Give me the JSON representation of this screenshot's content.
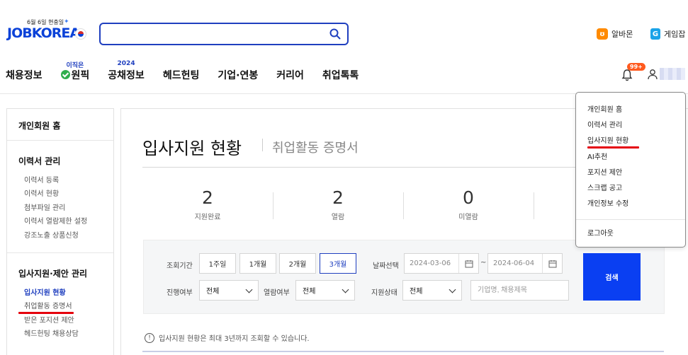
{
  "header": {
    "logo_tagline": "6월 6일 현충일",
    "logo_text": "JOBKOREA",
    "search_placeholder": "",
    "utils": [
      {
        "label": "알바몬",
        "badge": "ʊ"
      },
      {
        "label": "게임잡",
        "badge": "G"
      }
    ],
    "nav": [
      {
        "label": "채용정보",
        "sup": ""
      },
      {
        "label": "원픽",
        "sup": "이직은"
      },
      {
        "label": "공채정보",
        "sup": "2024"
      },
      {
        "label": "헤드헌팅",
        "sup": ""
      },
      {
        "label": "기업·연봉",
        "sup": ""
      },
      {
        "label": "커리어",
        "sup": ""
      },
      {
        "label": "취업톡톡",
        "sup": ""
      }
    ],
    "notification_badge": "99+"
  },
  "sidebar": {
    "home": "개인회원 홈",
    "sections": [
      {
        "title": "이력서 관리",
        "items": [
          "이력서 등록",
          "이력서 현황",
          "첨부파일 관리",
          "이력서 열람제한 설정",
          "강조노출 상품신청"
        ]
      },
      {
        "title": "입사지원·제안 관리",
        "items": [
          "입사지원 현황",
          "취업활동 증명서",
          "받은 포지션 제안",
          "헤드헌팅 채용상담"
        ]
      }
    ]
  },
  "main": {
    "title": "입사지원 현황",
    "subtitle": "취업활동 증명서",
    "stats": [
      {
        "value": "2",
        "label": "지원완료"
      },
      {
        "value": "2",
        "label": "열람"
      },
      {
        "value": "0",
        "label": "미열람"
      }
    ],
    "filter": {
      "period_label": "조회기간",
      "periods": [
        "1주일",
        "1개월",
        "2개월",
        "3개월"
      ],
      "active_period": "3개월",
      "date_label": "날짜선택",
      "date_from": "2024-03-06",
      "date_to": "2024-06-04",
      "tilde": "~",
      "progress_label": "진행여부",
      "progress_value": "전체",
      "read_label": "열람여부",
      "read_value": "전체",
      "status_label": "지원상태",
      "status_value": "전체",
      "keyword_placeholder": "기업명, 채용제목",
      "search_button": "검색"
    },
    "notice": "입사지원 현황은 최대 3년까지 조회할 수 있습니다."
  },
  "dropdown": {
    "items": [
      "개인회원 홈",
      "이력서 관리",
      "입사지원 현황",
      "AI추천",
      "포지션 제안",
      "스크랩 공고",
      "개인정보 수정"
    ],
    "logout": "로그아웃"
  },
  "colors": {
    "brand": "#0b42d8",
    "search_button": "#0a3ff2",
    "highlight_mark": "#e5000d",
    "badge": "#ff5a1f"
  }
}
